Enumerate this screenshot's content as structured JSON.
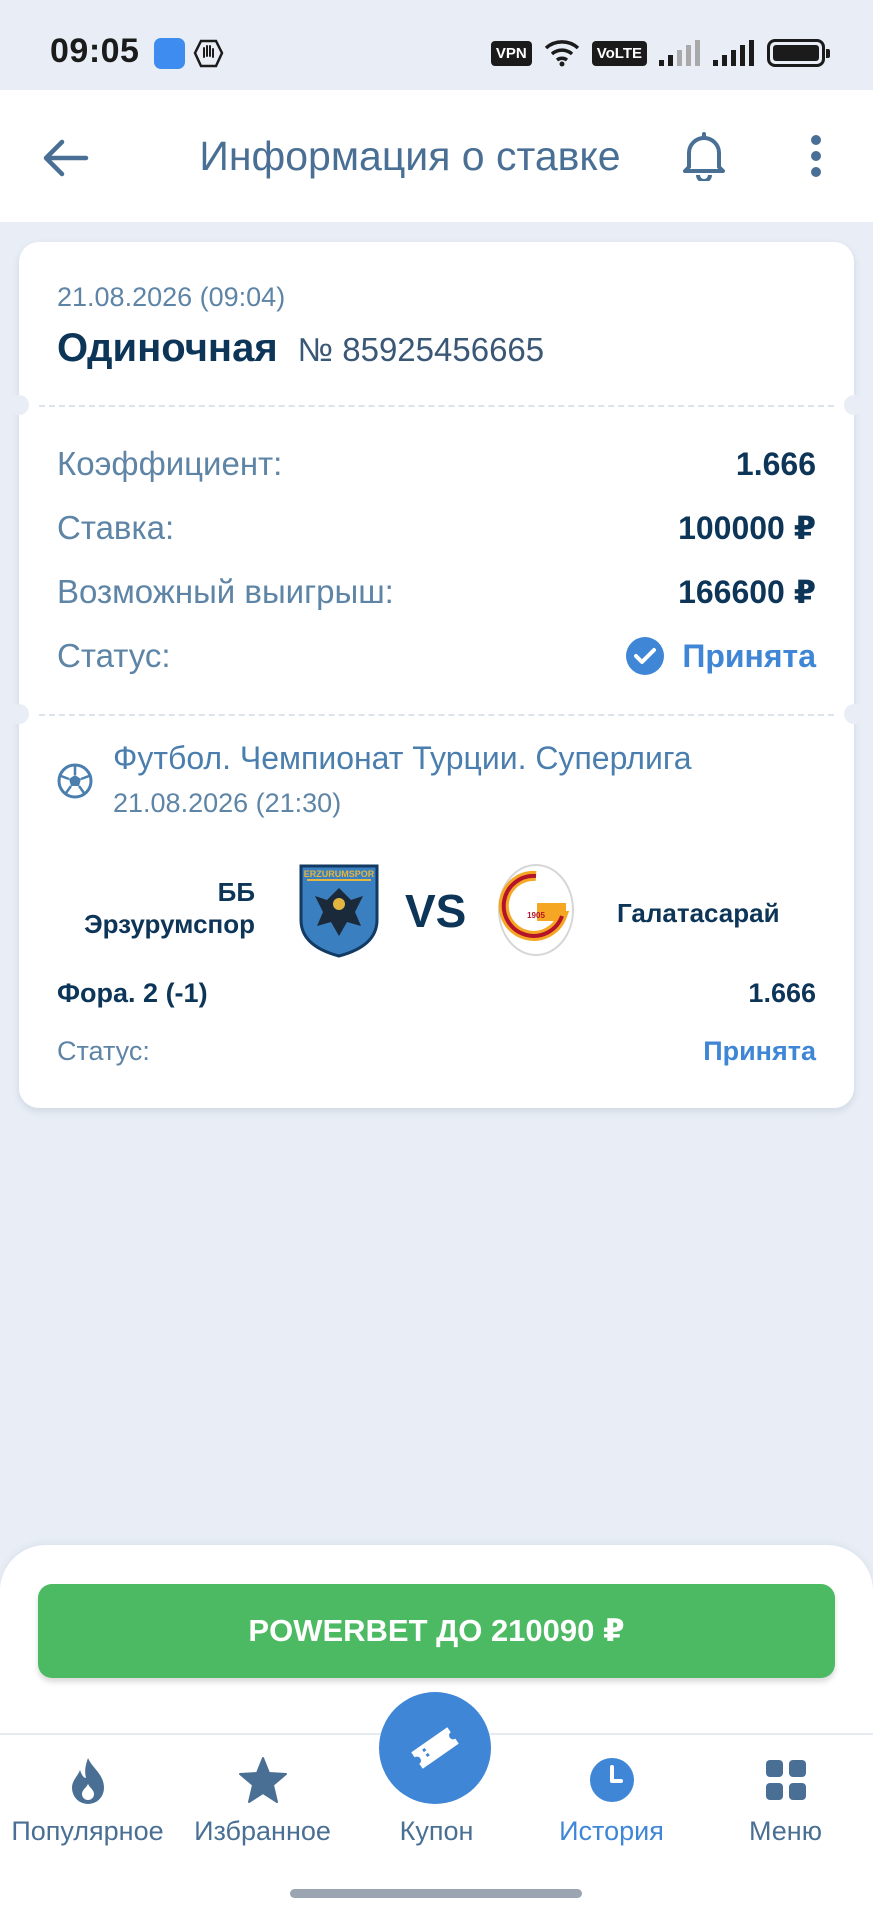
{
  "statusbar": {
    "time": "09:05",
    "vpn": "VPN",
    "volte": "VoLTE"
  },
  "header": {
    "title": "Информация о ставке"
  },
  "bet": {
    "date": "21.08.2026 (09:04)",
    "type": "Одиночная",
    "number": "№ 85925456665"
  },
  "details": [
    {
      "label": "Коэффициент:",
      "value": "1.666"
    },
    {
      "label": "Ставка:",
      "value": "100000 ₽"
    },
    {
      "label": "Возможный выигрыш:",
      "value": "166600 ₽"
    }
  ],
  "status": {
    "label": "Статус:",
    "value": "Принята"
  },
  "event": {
    "league": "Футбол. Чемпионат Турции. Суперлига",
    "date": "21.08.2026 (21:30)",
    "home_team": "ББ Эрзурумспор",
    "vs": "VS",
    "away_team": "Галатасарай",
    "home_logo_text": "ERZURUMSPOR",
    "away_logo_text": "1905",
    "outcome": "Фора. 2 (-1)",
    "odds": "1.666",
    "status_label": "Статус:",
    "status_value": "Принята"
  },
  "promo": {
    "label": "POWERBET ДО 210090 ₽"
  },
  "nav": [
    {
      "label": "Популярное",
      "icon": "fire-icon"
    },
    {
      "label": "Избранное",
      "icon": "star-icon"
    },
    {
      "label": "Купон",
      "icon": "ticket-icon"
    },
    {
      "label": "История",
      "icon": "clock-icon"
    },
    {
      "label": "Меню",
      "icon": "grid-icon"
    }
  ],
  "colors": {
    "accent": "#3f86d6",
    "promo": "#4cba63",
    "text_dark": "#0d3558",
    "text_muted": "#5e84a6",
    "background": "#e9eef6"
  }
}
